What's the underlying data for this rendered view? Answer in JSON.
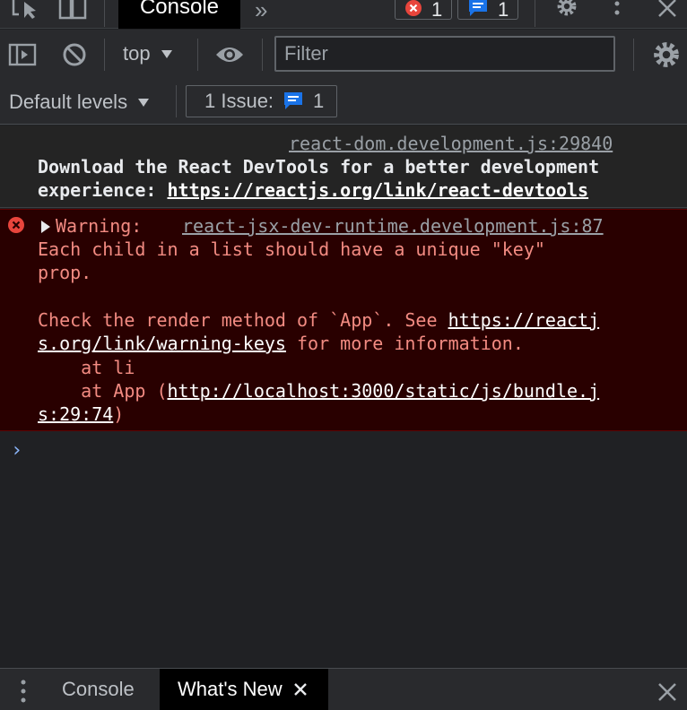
{
  "tabbar": {
    "active_tab": "Console",
    "error_count": "1",
    "message_count": "1"
  },
  "toolbar": {
    "context": "top",
    "filter_placeholder": "Filter"
  },
  "levels": {
    "label": "Default levels",
    "issues_label": "1 Issue:",
    "issues_count": "1"
  },
  "messages": {
    "info": {
      "source": "react-dom.development.js:29840",
      "line1": "Download the React DevTools for a better development",
      "line2_prefix": "experience: ",
      "link": "https://reactjs.org/link/react-devtools"
    },
    "error": {
      "label": "Warning:",
      "source": "react-jsx-dev-runtime.development.js:87",
      "line1": "Each child in a list should have a unique \"key\"",
      "line2": "prop.",
      "line3_prefix": "Check the render method of `App`. See ",
      "link_a": "https://reactj",
      "link_b": "s.org/link/warning-keys",
      "line4_suffix": " for more information.",
      "line5": "    at li",
      "line6_prefix": "    at App (",
      "link2_a": "http://localhost:3000/static/js/bundle.j",
      "link2_b": "s:29:74",
      "line7_suffix": ")"
    }
  },
  "drawer": {
    "tab_console": "Console",
    "tab_whats_new": "What's New"
  },
  "colors": {
    "error_bg": "#290000",
    "error_text": "#f28b82",
    "accent_blue": "#1a73e8",
    "error_red": "#e8453c"
  }
}
